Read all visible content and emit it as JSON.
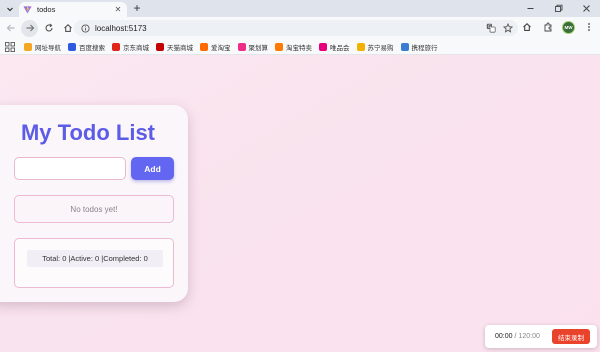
{
  "browser": {
    "tab": {
      "title": "todos",
      "favicon": "vite-logo-icon"
    },
    "address": "localhost:5173",
    "profile_initials": "MW",
    "window_controls": [
      "minimize-icon",
      "restore-icon",
      "close-icon"
    ]
  },
  "bookmarks": [
    {
      "label": "网址导航",
      "icon": "bookmark-icon",
      "color": "#f5a623"
    },
    {
      "label": "百度搜索",
      "icon": "paw-icon",
      "color": "#2f5ae0"
    },
    {
      "label": "京东商城",
      "icon": "jd-icon",
      "color": "#e1251b"
    },
    {
      "label": "天猫商城",
      "icon": "tmall-icon",
      "color": "#c40000"
    },
    {
      "label": "爱淘宝",
      "icon": "taobao-icon",
      "color": "#ff6a00"
    },
    {
      "label": "聚划算",
      "icon": "juhuasuan-icon",
      "color": "#ee2d86"
    },
    {
      "label": "淘宝特卖",
      "icon": "tag-icon",
      "color": "#ff7a00"
    },
    {
      "label": "唯品会",
      "icon": "vip-icon",
      "color": "#e6007e"
    },
    {
      "label": "苏宁易购",
      "icon": "suning-icon",
      "color": "#f2b100"
    },
    {
      "label": "携程旅行",
      "icon": "ctrip-icon",
      "color": "#3a7bd5"
    }
  ],
  "app": {
    "title": "My Todo List",
    "input": {
      "value": "",
      "placeholder": ""
    },
    "add_label": "Add",
    "empty_text": "No todos yet!",
    "stats": "Total: 0 |Active: 0 |Completed: 0",
    "colors": {
      "accent": "#6366f1",
      "title": "#5d5ce6",
      "border": "#edbad1"
    }
  },
  "recorder": {
    "elapsed": "00:00",
    "separator": "/",
    "total": "120:00",
    "stop_label": "结束录制",
    "stop_color": "#e9432c"
  }
}
